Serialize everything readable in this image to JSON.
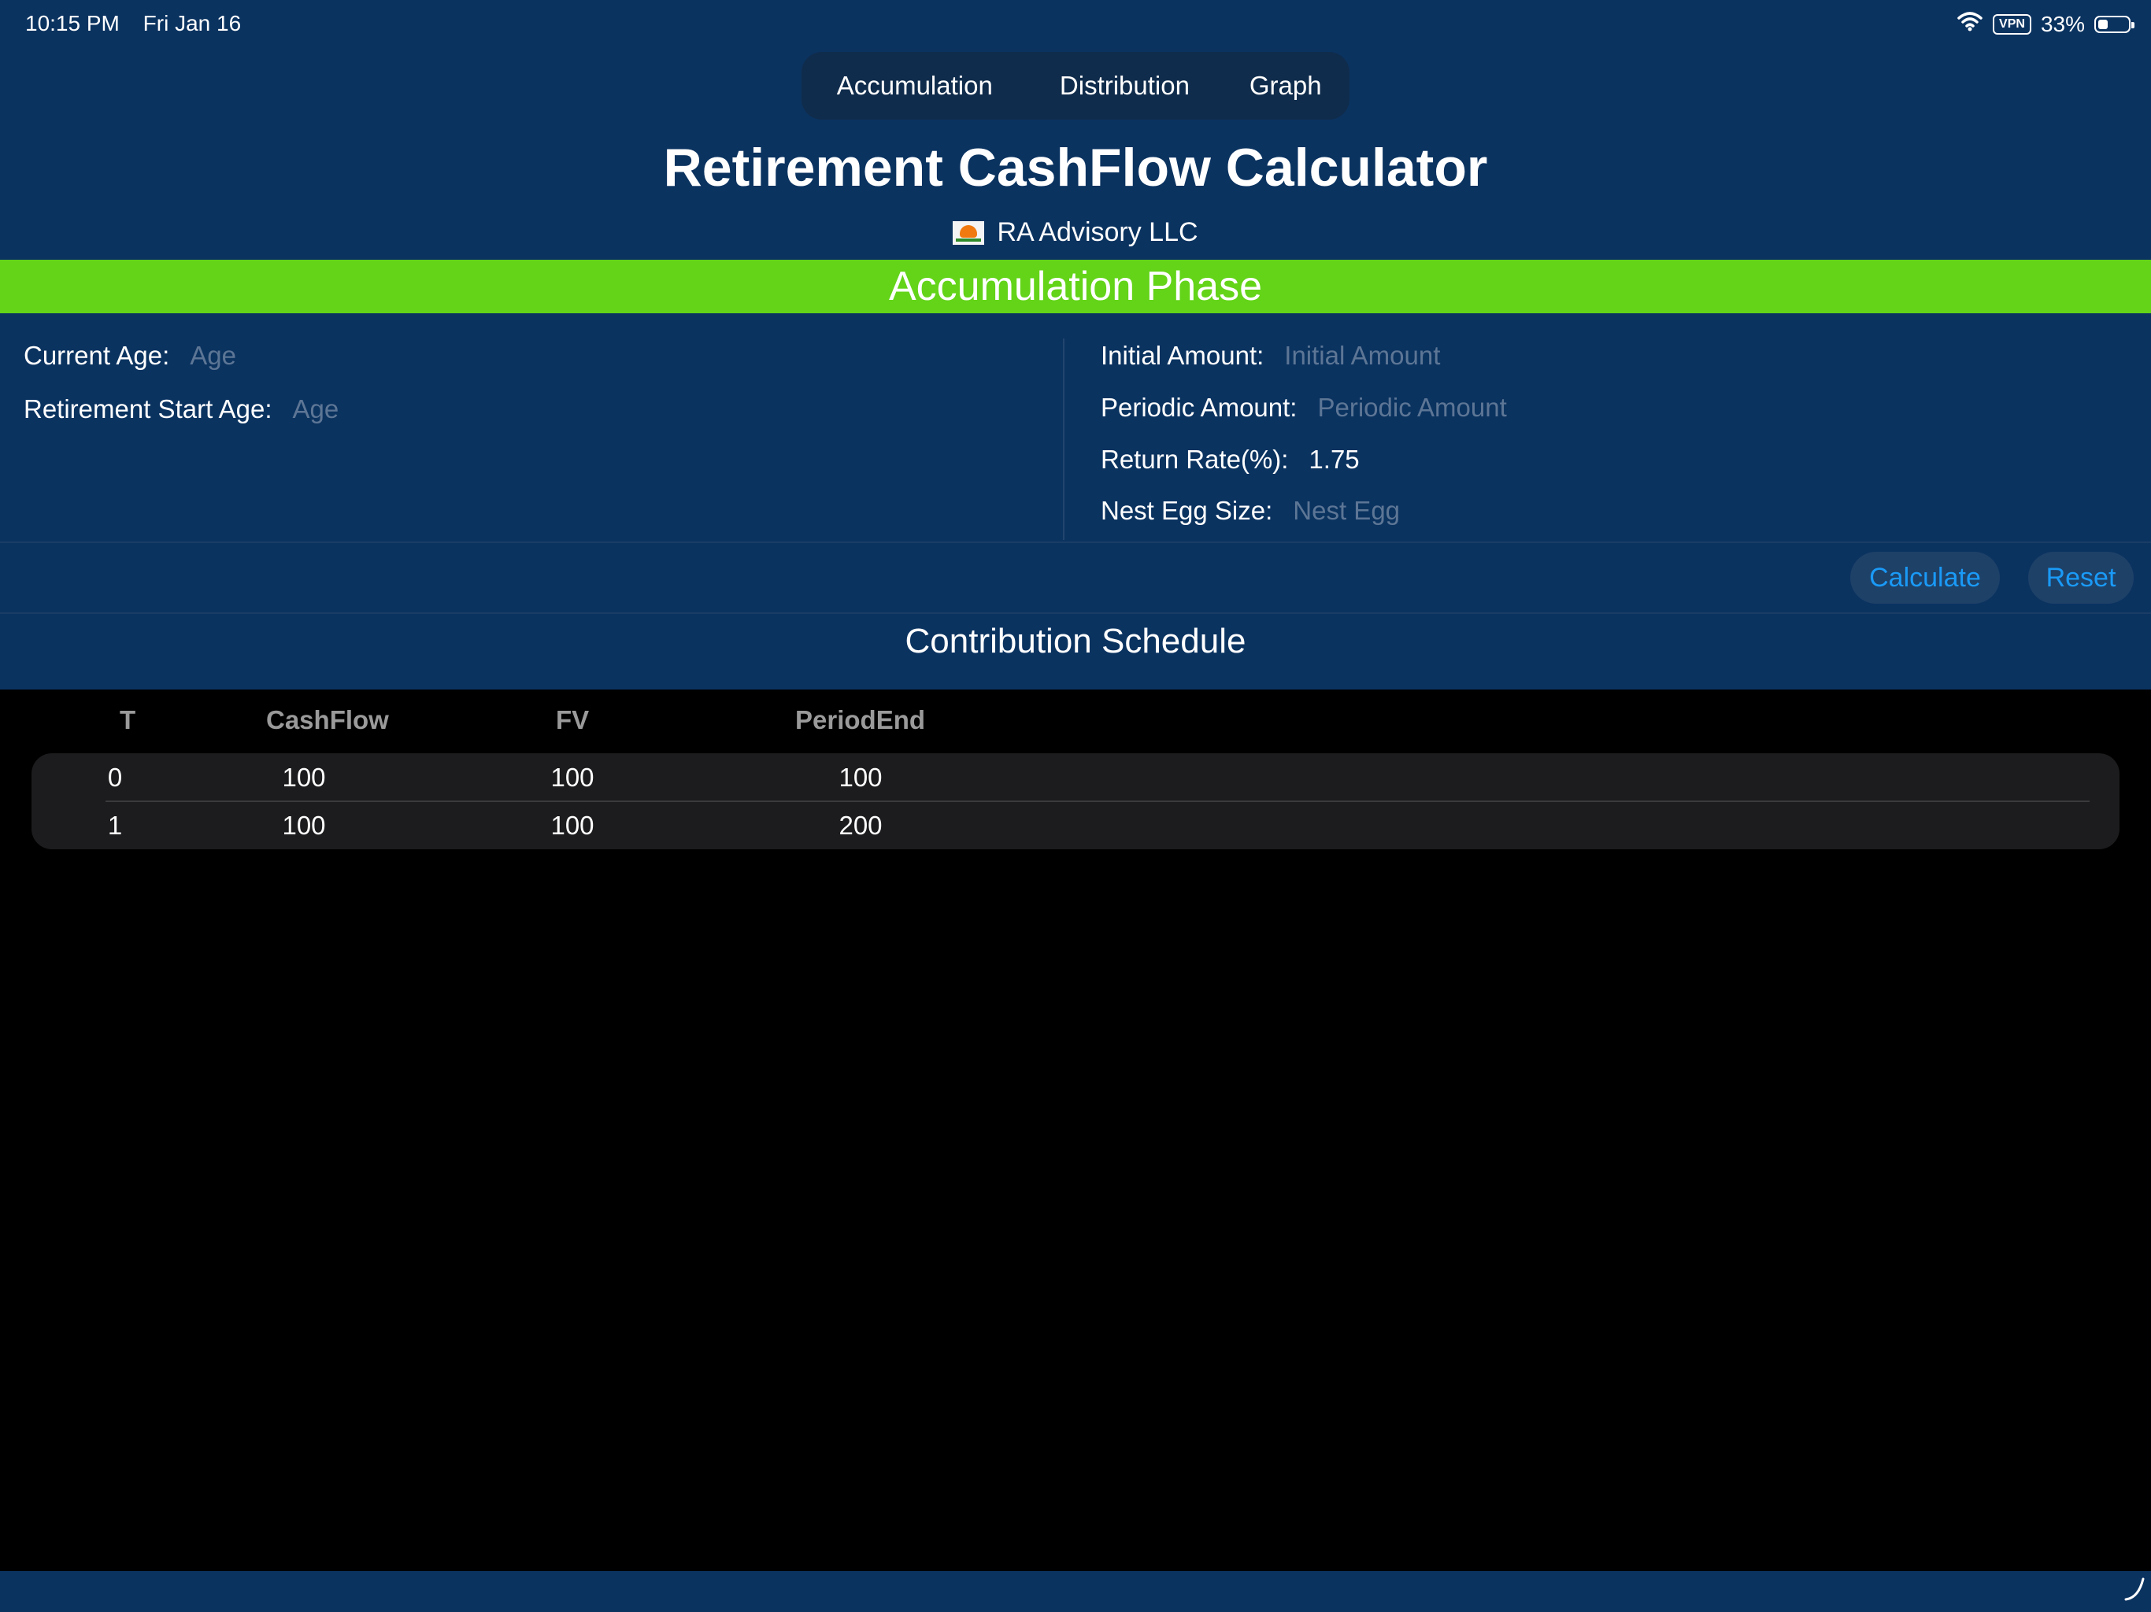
{
  "status_bar": {
    "time": "10:15 PM",
    "date": "Fri Jan 16",
    "vpn": "VPN",
    "battery_percent": "33%",
    "battery_level": 0.33
  },
  "tabs": [
    {
      "label": "Accumulation",
      "active": true
    },
    {
      "label": "Distribution",
      "active": false
    },
    {
      "label": "Graph",
      "active": false
    }
  ],
  "header": {
    "title": "Retirement CashFlow Calculator",
    "org": "RA Advisory LLC"
  },
  "phase_banner": "Accumulation Phase",
  "form": {
    "current_age": {
      "label": "Current Age:",
      "value": "",
      "placeholder": "Age"
    },
    "retirement_start_age": {
      "label": "Retirement Start Age:",
      "value": "",
      "placeholder": "Age"
    },
    "initial_amount": {
      "label": "Initial Amount:",
      "value": "",
      "placeholder": "Initial Amount"
    },
    "periodic_amount": {
      "label": "Periodic Amount:",
      "value": "",
      "placeholder": "Periodic Amount"
    },
    "return_rate": {
      "label": "Return Rate(%):",
      "value": "1.75",
      "placeholder": ""
    },
    "nest_egg_size": {
      "label": "Nest Egg Size:",
      "value": "",
      "placeholder": "Nest Egg"
    }
  },
  "actions": {
    "calculate": "Calculate",
    "reset": "Reset"
  },
  "schedule": {
    "title": "Contribution Schedule",
    "columns": [
      "T",
      "CashFlow",
      "FV",
      "PeriodEnd"
    ],
    "rows": [
      [
        "0",
        "100",
        "100",
        "100"
      ],
      [
        "1",
        "100",
        "100",
        "200"
      ]
    ]
  },
  "colors": {
    "background": "#0b3360",
    "accent": "#1a9af7",
    "phase_banner": "#63d418",
    "table_card": "#1c1c1e"
  },
  "icons": [
    "wifi-icon",
    "vpn-badge",
    "battery-icon",
    "org-logo",
    "corner-hook-icon"
  ]
}
